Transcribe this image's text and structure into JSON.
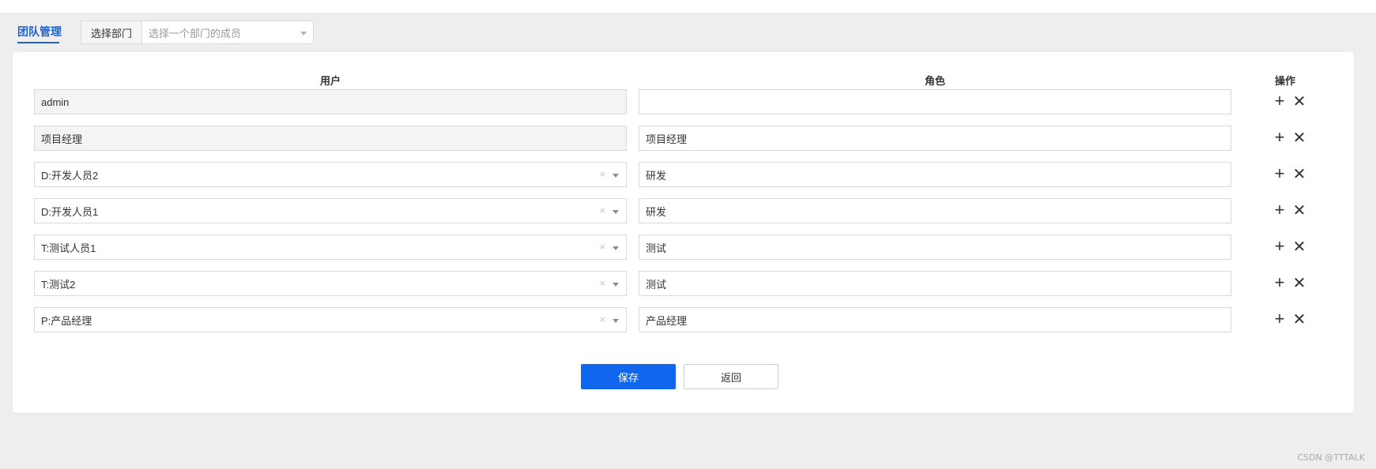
{
  "header": {
    "tab_label": "团队管理",
    "dept_label": "选择部门",
    "dept_placeholder": "选择一个部门的成员"
  },
  "table": {
    "columns": {
      "user": "用户",
      "role": "角色",
      "op": "操作"
    },
    "rows": [
      {
        "user": "admin",
        "role": "",
        "user_readonly": true
      },
      {
        "user": "项目经理",
        "role": "项目经理",
        "user_readonly": true
      },
      {
        "user": "D:开发人员2",
        "role": "研发",
        "user_readonly": false
      },
      {
        "user": "D:开发人员1",
        "role": "研发",
        "user_readonly": false
      },
      {
        "user": "T:测试人员1",
        "role": "测试",
        "user_readonly": false
      },
      {
        "user": "T:测试2",
        "role": "测试",
        "user_readonly": false
      },
      {
        "user": "P:产品经理",
        "role": "产品经理",
        "user_readonly": false
      }
    ],
    "add_icon": "plus-icon",
    "remove_icon": "close-icon"
  },
  "actions": {
    "save_label": "保存",
    "back_label": "返回"
  },
  "colors": {
    "accent": "#1166ee",
    "tab_active": "#1f63d6",
    "background": "#eeeeee"
  },
  "watermark": "CSDN @TTTALK"
}
